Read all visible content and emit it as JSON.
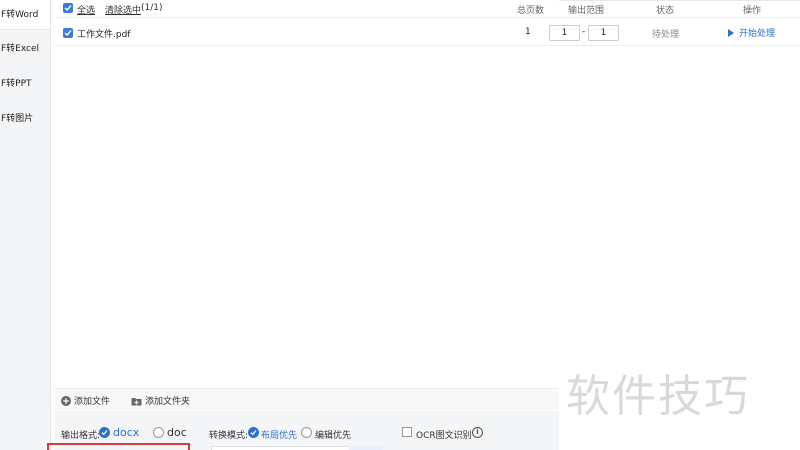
{
  "sidebar": {
    "items": [
      {
        "label": "F转Word",
        "active": true
      },
      {
        "label": "F转Excel",
        "active": false
      },
      {
        "label": "F转PPT",
        "active": false
      },
      {
        "label": "F转图片",
        "active": false
      }
    ]
  },
  "header": {
    "select_all": "全选",
    "clear_selection": "清除选中",
    "count": "(1/1)",
    "columns": {
      "total_pages": "总页数",
      "output_range": "输出范围",
      "status": "状态",
      "action": "操作"
    }
  },
  "files": [
    {
      "name": "工作文件.pdf",
      "checked": true,
      "total_pages": "1",
      "range_start": "1",
      "range_separator": "-",
      "range_end": "1",
      "status": "待处理",
      "action": "开始处理"
    }
  ],
  "toolbar": {
    "add_file": "添加文件",
    "add_folder": "添加文件夹"
  },
  "settings": {
    "output_format_label": "输出格式:",
    "format_docx": "docx",
    "format_doc": "doc",
    "selected_format": "docx",
    "convert_mode_label": "转换模式:",
    "mode_layout": "布局优先",
    "mode_edit": "编辑优先",
    "selected_mode": "布局优先",
    "ocr_label": "OCR图文识别",
    "ocr_checked": false
  },
  "watermark": "软件技巧",
  "colors": {
    "accent": "#2d6fcf",
    "highlight_box": "#d93a3a",
    "sidebar_bg": "#f4f5f7"
  }
}
